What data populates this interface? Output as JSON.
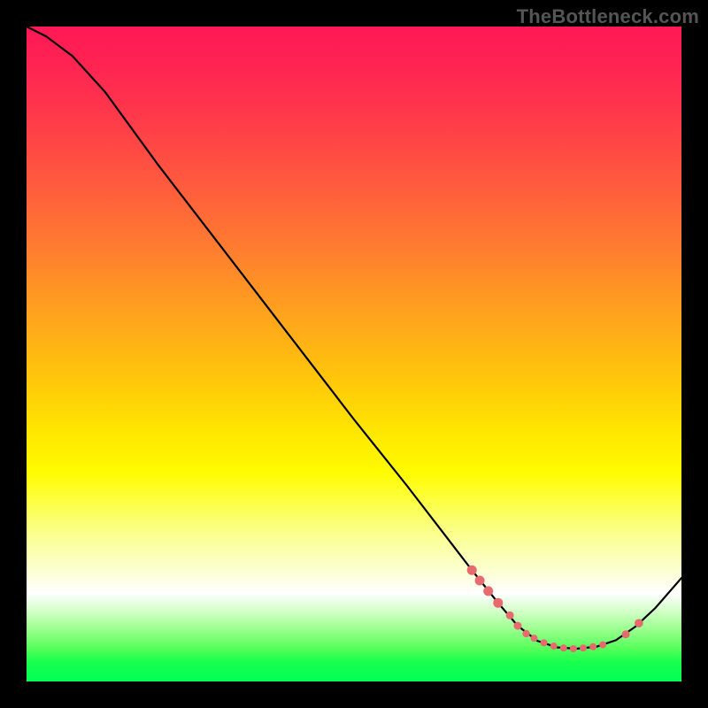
{
  "attribution": "TheBottleneck.com",
  "chart_data": {
    "type": "line",
    "title": "",
    "xlabel": "",
    "ylabel": "",
    "xlim": [
      0,
      100
    ],
    "ylim": [
      0,
      100
    ],
    "curve": [
      {
        "x": 0,
        "y": 100
      },
      {
        "x": 3,
        "y": 98.5
      },
      {
        "x": 7,
        "y": 95.5
      },
      {
        "x": 12,
        "y": 90
      },
      {
        "x": 20,
        "y": 79
      },
      {
        "x": 30,
        "y": 66
      },
      {
        "x": 40,
        "y": 53
      },
      {
        "x": 50,
        "y": 40
      },
      {
        "x": 58,
        "y": 30
      },
      {
        "x": 63,
        "y": 23.5
      },
      {
        "x": 68,
        "y": 17
      },
      {
        "x": 72,
        "y": 12
      },
      {
        "x": 75,
        "y": 8.5
      },
      {
        "x": 78,
        "y": 6.2
      },
      {
        "x": 81,
        "y": 5.2
      },
      {
        "x": 84,
        "y": 5.0
      },
      {
        "x": 87,
        "y": 5.3
      },
      {
        "x": 90,
        "y": 6.3
      },
      {
        "x": 93,
        "y": 8.4
      },
      {
        "x": 96,
        "y": 11.2
      },
      {
        "x": 100,
        "y": 15.8
      }
    ],
    "markers": [
      {
        "x": 68.0,
        "y": 17.0,
        "r": 5.5
      },
      {
        "x": 69.2,
        "y": 15.4,
        "r": 5.5
      },
      {
        "x": 70.5,
        "y": 13.8,
        "r": 5.5
      },
      {
        "x": 72.0,
        "y": 12.0,
        "r": 5.5
      },
      {
        "x": 73.8,
        "y": 10.1,
        "r": 4.5
      },
      {
        "x": 75.0,
        "y": 8.5,
        "r": 4.5
      },
      {
        "x": 76.3,
        "y": 7.3,
        "r": 4.2
      },
      {
        "x": 77.5,
        "y": 6.6,
        "r": 4.0
      },
      {
        "x": 79.0,
        "y": 5.9,
        "r": 4.0
      },
      {
        "x": 80.5,
        "y": 5.4,
        "r": 4.0
      },
      {
        "x": 82.0,
        "y": 5.1,
        "r": 4.0
      },
      {
        "x": 83.5,
        "y": 5.0,
        "r": 4.0
      },
      {
        "x": 85.0,
        "y": 5.1,
        "r": 4.0
      },
      {
        "x": 86.5,
        "y": 5.3,
        "r": 4.0
      },
      {
        "x": 88.0,
        "y": 5.6,
        "r": 4.0
      },
      {
        "x": 91.5,
        "y": 7.2,
        "r": 4.5
      },
      {
        "x": 93.5,
        "y": 8.9,
        "r": 4.8
      }
    ],
    "gradient_stops": [
      {
        "pos": 0.0,
        "color": "#ff1856"
      },
      {
        "pos": 0.5,
        "color": "#ffd400"
      },
      {
        "pos": 0.86,
        "color": "#ffffff"
      },
      {
        "pos": 1.0,
        "color": "#00ff55"
      }
    ]
  }
}
